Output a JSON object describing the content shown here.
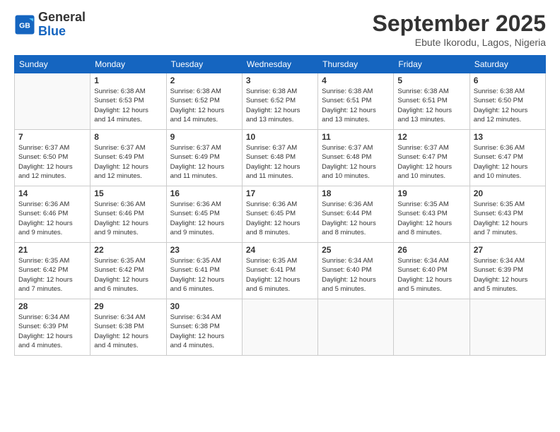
{
  "logo": {
    "general": "General",
    "blue": "Blue"
  },
  "title": "September 2025",
  "location": "Ebute Ikorodu, Lagos, Nigeria",
  "days_of_week": [
    "Sunday",
    "Monday",
    "Tuesday",
    "Wednesday",
    "Thursday",
    "Friday",
    "Saturday"
  ],
  "weeks": [
    [
      {
        "day": "",
        "info": ""
      },
      {
        "day": "1",
        "info": "Sunrise: 6:38 AM\nSunset: 6:53 PM\nDaylight: 12 hours\nand 14 minutes."
      },
      {
        "day": "2",
        "info": "Sunrise: 6:38 AM\nSunset: 6:52 PM\nDaylight: 12 hours\nand 14 minutes."
      },
      {
        "day": "3",
        "info": "Sunrise: 6:38 AM\nSunset: 6:52 PM\nDaylight: 12 hours\nand 13 minutes."
      },
      {
        "day": "4",
        "info": "Sunrise: 6:38 AM\nSunset: 6:51 PM\nDaylight: 12 hours\nand 13 minutes."
      },
      {
        "day": "5",
        "info": "Sunrise: 6:38 AM\nSunset: 6:51 PM\nDaylight: 12 hours\nand 13 minutes."
      },
      {
        "day": "6",
        "info": "Sunrise: 6:38 AM\nSunset: 6:50 PM\nDaylight: 12 hours\nand 12 minutes."
      }
    ],
    [
      {
        "day": "7",
        "info": "Sunrise: 6:37 AM\nSunset: 6:50 PM\nDaylight: 12 hours\nand 12 minutes."
      },
      {
        "day": "8",
        "info": "Sunrise: 6:37 AM\nSunset: 6:49 PM\nDaylight: 12 hours\nand 12 minutes."
      },
      {
        "day": "9",
        "info": "Sunrise: 6:37 AM\nSunset: 6:49 PM\nDaylight: 12 hours\nand 11 minutes."
      },
      {
        "day": "10",
        "info": "Sunrise: 6:37 AM\nSunset: 6:48 PM\nDaylight: 12 hours\nand 11 minutes."
      },
      {
        "day": "11",
        "info": "Sunrise: 6:37 AM\nSunset: 6:48 PM\nDaylight: 12 hours\nand 10 minutes."
      },
      {
        "day": "12",
        "info": "Sunrise: 6:37 AM\nSunset: 6:47 PM\nDaylight: 12 hours\nand 10 minutes."
      },
      {
        "day": "13",
        "info": "Sunrise: 6:36 AM\nSunset: 6:47 PM\nDaylight: 12 hours\nand 10 minutes."
      }
    ],
    [
      {
        "day": "14",
        "info": "Sunrise: 6:36 AM\nSunset: 6:46 PM\nDaylight: 12 hours\nand 9 minutes."
      },
      {
        "day": "15",
        "info": "Sunrise: 6:36 AM\nSunset: 6:46 PM\nDaylight: 12 hours\nand 9 minutes."
      },
      {
        "day": "16",
        "info": "Sunrise: 6:36 AM\nSunset: 6:45 PM\nDaylight: 12 hours\nand 9 minutes."
      },
      {
        "day": "17",
        "info": "Sunrise: 6:36 AM\nSunset: 6:45 PM\nDaylight: 12 hours\nand 8 minutes."
      },
      {
        "day": "18",
        "info": "Sunrise: 6:36 AM\nSunset: 6:44 PM\nDaylight: 12 hours\nand 8 minutes."
      },
      {
        "day": "19",
        "info": "Sunrise: 6:35 AM\nSunset: 6:43 PM\nDaylight: 12 hours\nand 8 minutes."
      },
      {
        "day": "20",
        "info": "Sunrise: 6:35 AM\nSunset: 6:43 PM\nDaylight: 12 hours\nand 7 minutes."
      }
    ],
    [
      {
        "day": "21",
        "info": "Sunrise: 6:35 AM\nSunset: 6:42 PM\nDaylight: 12 hours\nand 7 minutes."
      },
      {
        "day": "22",
        "info": "Sunrise: 6:35 AM\nSunset: 6:42 PM\nDaylight: 12 hours\nand 6 minutes."
      },
      {
        "day": "23",
        "info": "Sunrise: 6:35 AM\nSunset: 6:41 PM\nDaylight: 12 hours\nand 6 minutes."
      },
      {
        "day": "24",
        "info": "Sunrise: 6:35 AM\nSunset: 6:41 PM\nDaylight: 12 hours\nand 6 minutes."
      },
      {
        "day": "25",
        "info": "Sunrise: 6:34 AM\nSunset: 6:40 PM\nDaylight: 12 hours\nand 5 minutes."
      },
      {
        "day": "26",
        "info": "Sunrise: 6:34 AM\nSunset: 6:40 PM\nDaylight: 12 hours\nand 5 minutes."
      },
      {
        "day": "27",
        "info": "Sunrise: 6:34 AM\nSunset: 6:39 PM\nDaylight: 12 hours\nand 5 minutes."
      }
    ],
    [
      {
        "day": "28",
        "info": "Sunrise: 6:34 AM\nSunset: 6:39 PM\nDaylight: 12 hours\nand 4 minutes."
      },
      {
        "day": "29",
        "info": "Sunrise: 6:34 AM\nSunset: 6:38 PM\nDaylight: 12 hours\nand 4 minutes."
      },
      {
        "day": "30",
        "info": "Sunrise: 6:34 AM\nSunset: 6:38 PM\nDaylight: 12 hours\nand 4 minutes."
      },
      {
        "day": "",
        "info": ""
      },
      {
        "day": "",
        "info": ""
      },
      {
        "day": "",
        "info": ""
      },
      {
        "day": "",
        "info": ""
      }
    ]
  ]
}
